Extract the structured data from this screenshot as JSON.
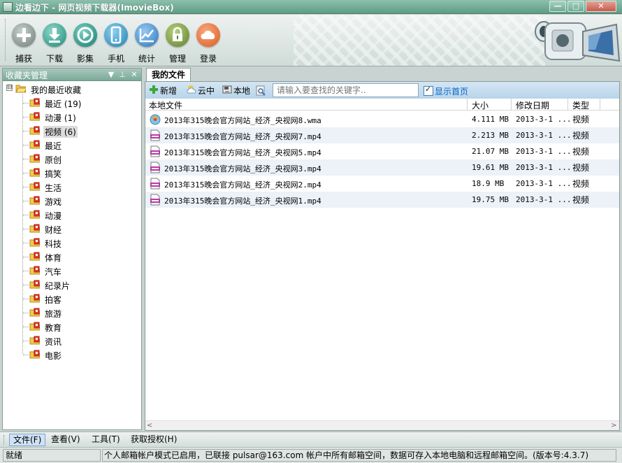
{
  "window": {
    "title": "边看边下 - 网页视频下载器(ImovieBox)",
    "controls": {
      "minimize": "—",
      "maximize": "□",
      "close": "✕"
    }
  },
  "toolbar": {
    "items": [
      {
        "label": "捕获",
        "icon": "plus-icon",
        "color": "#7c8a86"
      },
      {
        "label": "下载",
        "icon": "download-icon",
        "color": "#2d9a8b"
      },
      {
        "label": "影集",
        "icon": "play-icon",
        "color": "#1f8f7f"
      },
      {
        "label": "手机",
        "icon": "phone-icon",
        "color": "#2d8fc0"
      },
      {
        "label": "统计",
        "icon": "chart-icon",
        "color": "#3787c6"
      },
      {
        "label": "管理",
        "icon": "lock-icon",
        "color": "#6f8f3a"
      },
      {
        "label": "登录",
        "icon": "cloud-icon",
        "color": "#e5652a"
      }
    ]
  },
  "left_panel": {
    "title": "收藏夹管理",
    "buttons": {
      "dropdown": "▼",
      "pin": "⊥",
      "close": "✕"
    },
    "tree": {
      "toggle": "⊟",
      "root": "我的最近收藏",
      "items": [
        {
          "label": "最近 (19)"
        },
        {
          "label": "动漫 (1)"
        },
        {
          "label": "视频 (6)",
          "selected": true
        },
        {
          "label": "最近"
        },
        {
          "label": "原创"
        },
        {
          "label": "搞笑"
        },
        {
          "label": "生活"
        },
        {
          "label": "游戏"
        },
        {
          "label": "动漫"
        },
        {
          "label": "财经"
        },
        {
          "label": "科技"
        },
        {
          "label": "体育"
        },
        {
          "label": "汽车"
        },
        {
          "label": "纪录片"
        },
        {
          "label": "拍客"
        },
        {
          "label": "旅游"
        },
        {
          "label": "教育"
        },
        {
          "label": "资讯"
        },
        {
          "label": "电影"
        }
      ]
    }
  },
  "right_panel": {
    "tab": "我的文件",
    "actions": {
      "add": "新增",
      "cloud": "云中",
      "local": "本地"
    },
    "search": {
      "placeholder": "请输入要查找的关键字..",
      "value": ""
    },
    "show_home": "显示首页",
    "columns": {
      "file": "本地文件",
      "size": "大小",
      "modified": "修改日期",
      "type": "类型"
    },
    "files": [
      {
        "name": "2013年315晚会官方网站_经济_央视网8.wma",
        "size": "4.111 MB",
        "date": "2013-3-1 ...",
        "type": "视频",
        "kind": "audio"
      },
      {
        "name": "2013年315晚会官方网站_经济_央视网7.mp4",
        "size": "2.213 MB",
        "date": "2013-3-1 ...",
        "type": "视频",
        "kind": "video"
      },
      {
        "name": "2013年315晚会官方网站_经济_央视网5.mp4",
        "size": "21.07 MB",
        "date": "2013-3-1 ...",
        "type": "视频",
        "kind": "video"
      },
      {
        "name": "2013年315晚会官方网站_经济_央视网3.mp4",
        "size": "19.61 MB",
        "date": "2013-3-1 ...",
        "type": "视频",
        "kind": "video"
      },
      {
        "name": "2013年315晚会官方网站_经济_央视网2.mp4",
        "size": "18.9 MB",
        "date": "2013-3-1 ...",
        "type": "视频",
        "kind": "video"
      },
      {
        "name": "2013年315晚会官方网站_经济_央视网1.mp4",
        "size": "19.75 MB",
        "date": "2013-3-1 ...",
        "type": "视频",
        "kind": "video"
      }
    ],
    "scroll": {
      "left": "<",
      "right": ">"
    }
  },
  "bottom_menu": {
    "items": [
      "文件(F)",
      "查看(V)",
      "工具(T)",
      "获取授权(H)"
    ]
  },
  "statusbar": {
    "ready": "就绪",
    "message": "个人邮箱帐户模式已启用，已联接 pulsar@163.com 帐户中所有邮箱空间，数据可存入本地电脑和远程邮箱空间。(版本号:4.3.7)"
  }
}
